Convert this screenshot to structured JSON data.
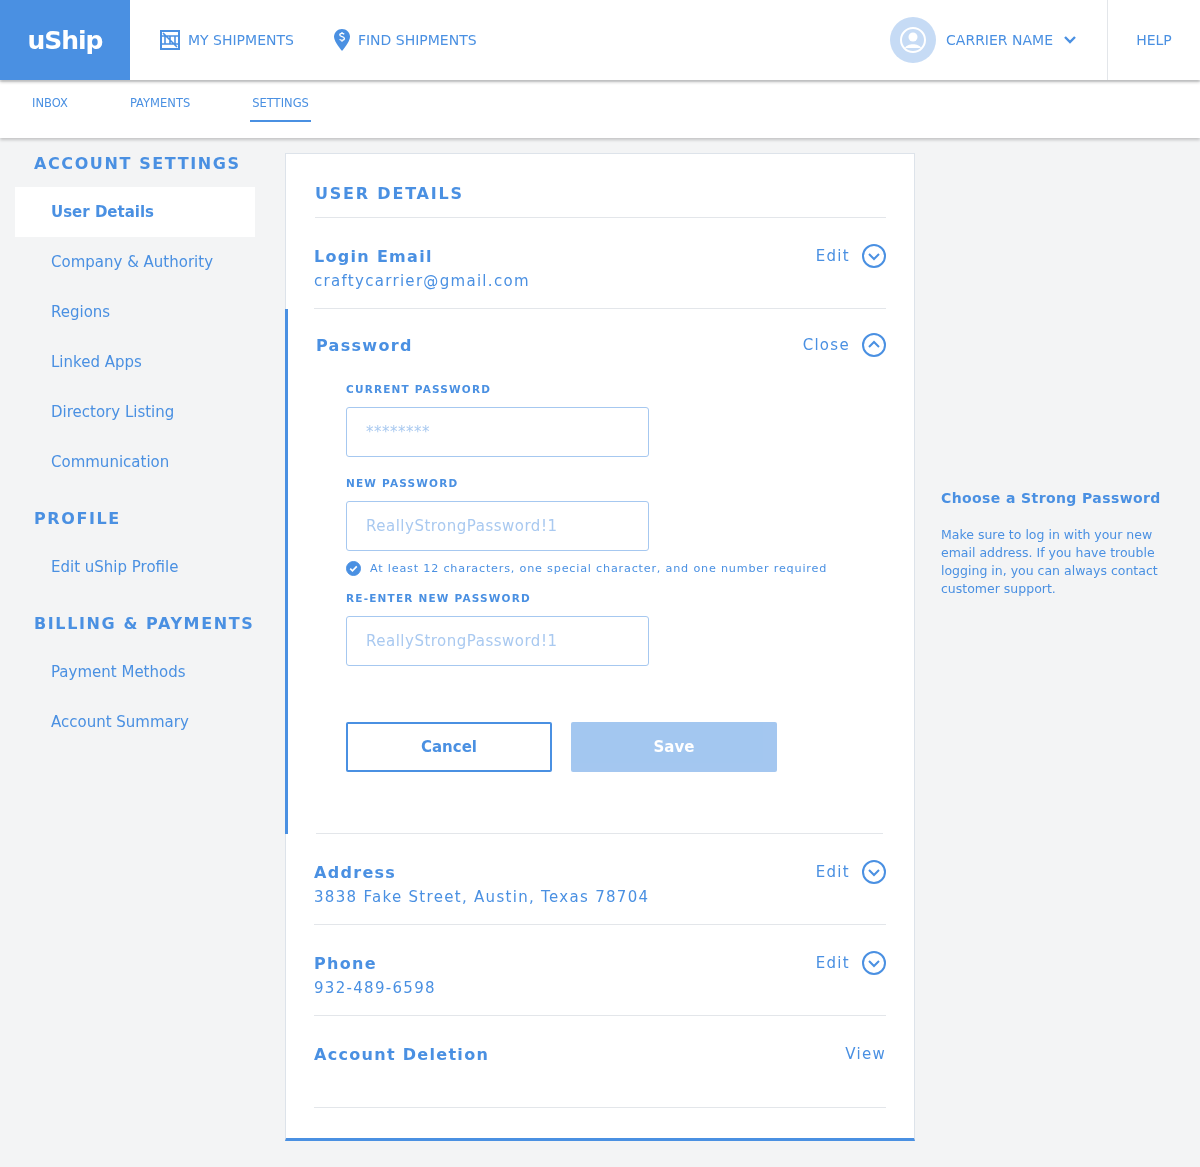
{
  "header": {
    "logo": "uShip",
    "nav": [
      {
        "label": "MY SHIPMENTS"
      },
      {
        "label": "FIND SHIPMENTS"
      }
    ],
    "user": {
      "name": "CARRIER NAME"
    },
    "help": "HELP"
  },
  "tabs": [
    {
      "label": "INBOX",
      "selected": false
    },
    {
      "label": "PAYMENTS",
      "selected": false
    },
    {
      "label": "SETTINGS",
      "selected": true
    }
  ],
  "sidebar": [
    {
      "heading": "ACCOUNT SETTINGS",
      "items": [
        {
          "label": "User Details",
          "selected": true
        },
        {
          "label": "Company & Authority",
          "selected": false
        },
        {
          "label": "Regions",
          "selected": false
        },
        {
          "label": "Linked Apps",
          "selected": false
        },
        {
          "label": "Directory Listing",
          "selected": false
        },
        {
          "label": "Communication",
          "selected": false
        }
      ]
    },
    {
      "heading": "PROFILE",
      "items": [
        {
          "label": "Edit uShip Profile",
          "selected": false
        }
      ]
    },
    {
      "heading": "BILLING & PAYMENTS",
      "items": [
        {
          "label": "Payment Methods",
          "selected": false
        },
        {
          "label": "Account Summary",
          "selected": false
        }
      ]
    }
  ],
  "card": {
    "title": "USER DETAILS",
    "sections": [
      {
        "label": "Login Email",
        "value": "craftycarrier@gmail.com",
        "action": "Edit",
        "expanded": false
      },
      {
        "label": "Password",
        "action": "Close",
        "expanded": true,
        "fields": [
          {
            "label": "CURRENT PASSWORD",
            "placeholder": "********"
          },
          {
            "label": "NEW PASSWORD",
            "placeholder": "ReallyStrongPassword!1",
            "hint": {
              "text": "At least 12 characters, one special character, and one number required",
              "met": true
            }
          },
          {
            "label": "RE-ENTER NEW PASSWORD",
            "placeholder": "ReallyStrongPassword!1"
          }
        ],
        "buttons": [
          {
            "label": "Cancel",
            "kind": "secondary",
            "disabled": false
          },
          {
            "label": "Save",
            "kind": "primary",
            "disabled": true
          }
        ]
      },
      {
        "label": "Address",
        "value": "3838 Fake Street, Austin, Texas 78704",
        "action": "Edit",
        "expanded": false
      },
      {
        "label": "Phone",
        "value": "932-489-6598",
        "action": "Edit",
        "expanded": false
      },
      {
        "label": "Account Deletion",
        "action": "View"
      }
    ]
  },
  "tip": {
    "title": "Choose a Strong Password",
    "text": "Make sure to log in with your new email address. If you have trouble logging in, you can always contact customer support."
  }
}
